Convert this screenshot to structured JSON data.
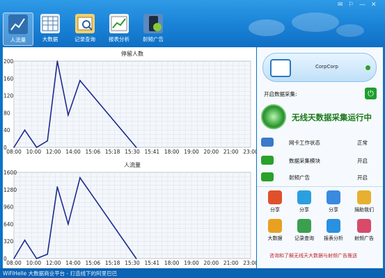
{
  "window": {
    "controls": [
      "✉",
      "⚐",
      "—",
      "✕"
    ]
  },
  "toolbar": {
    "items": [
      {
        "label": "人流量",
        "active": true,
        "color": "#2f6fb0"
      },
      {
        "label": "大数据",
        "active": false,
        "color": "#e8f0f8"
      },
      {
        "label": "记录查询",
        "active": false,
        "color": "#f2d070"
      },
      {
        "label": "报表分析",
        "active": false,
        "color": "#f3f3f3"
      },
      {
        "label": "射频广告",
        "active": false,
        "color": "#5a8ac0"
      }
    ]
  },
  "charts": [
    {
      "title": "停留人数",
      "yticks": [
        "200",
        "160",
        "120",
        "80",
        "40",
        "0"
      ],
      "xticks": [
        "08:00",
        "10:00",
        "12:00",
        "14:00",
        "15:06",
        "15:18",
        "15:30",
        "15:41",
        "18:00",
        "19:00",
        "20:00",
        "21:00",
        "23:00"
      ]
    },
    {
      "title": "人流量",
      "yticks": [
        "1600",
        "1280",
        "960",
        "640",
        "320",
        "0"
      ],
      "xticks": [
        "08:00",
        "10:00",
        "12:00",
        "14:00",
        "15:06",
        "15:18",
        "15:30",
        "15:41",
        "18:00",
        "19:00",
        "20:00",
        "21:00",
        "23:00"
      ]
    }
  ],
  "chart_data": [
    {
      "type": "line",
      "title": "停留人数",
      "categories": [
        "08:00",
        "10:00",
        "12:00",
        "14:00",
        "15:06",
        "15:18",
        "15:30",
        "15:41",
        "18:00",
        "19:00",
        "20:00",
        "21:00",
        "23:00"
      ],
      "x": [
        0,
        0.55,
        1.15,
        1.7,
        2.2,
        2.75,
        3.35,
        6.2
      ],
      "y": [
        0,
        40,
        0,
        15,
        200,
        75,
        155,
        0
      ],
      "ylim": [
        0,
        200
      ],
      "color": "#1c2a8c"
    },
    {
      "type": "line",
      "title": "人流量",
      "categories": [
        "08:00",
        "10:00",
        "12:00",
        "14:00",
        "15:06",
        "15:18",
        "15:30",
        "15:41",
        "18:00",
        "19:00",
        "20:00",
        "21:00",
        "23:00"
      ],
      "x": [
        0,
        0.55,
        1.15,
        1.7,
        2.2,
        2.75,
        3.35,
        6.2
      ],
      "y": [
        0,
        340,
        0,
        80,
        1330,
        640,
        1500,
        0
      ],
      "ylim": [
        0,
        1600
      ],
      "color": "#1c2a8c"
    }
  ],
  "right": {
    "router_name": "CorpCorp",
    "collect_label": "开启数据采集:",
    "power_symbol": "⏻",
    "running_text": "无线天数据采集运行中",
    "status_rows": [
      {
        "name": "网卡工作状态",
        "value": "正常",
        "icon_color": "#3a7ac8"
      },
      {
        "name": "数据采集模块",
        "value": "开启",
        "icon_color": "#2aa12a"
      },
      {
        "name": "射频广告",
        "value": "开启",
        "icon_color": "#2aa12a"
      }
    ],
    "apps_row1": [
      {
        "label": "分享",
        "color": "#e0502a"
      },
      {
        "label": "分享",
        "color": "#2aa0e0"
      },
      {
        "label": "分享",
        "color": "#3a8ae0"
      },
      {
        "label": "捐助我们",
        "color": "#e8b030"
      }
    ],
    "apps_row2": [
      {
        "label": "大数据",
        "color": "#e8a020"
      },
      {
        "label": "记录查询",
        "color": "#3aa050"
      },
      {
        "label": "报表分析",
        "color": "#2a90e0"
      },
      {
        "label": "射频广告",
        "color": "#d84a6a"
      }
    ],
    "promo_text": "咨询和了解无线天大数据与射频广告推送"
  },
  "statusbar": {
    "text": "WiFiHelle 大数据商业平台 - 打造线下的阿里巴巴"
  }
}
